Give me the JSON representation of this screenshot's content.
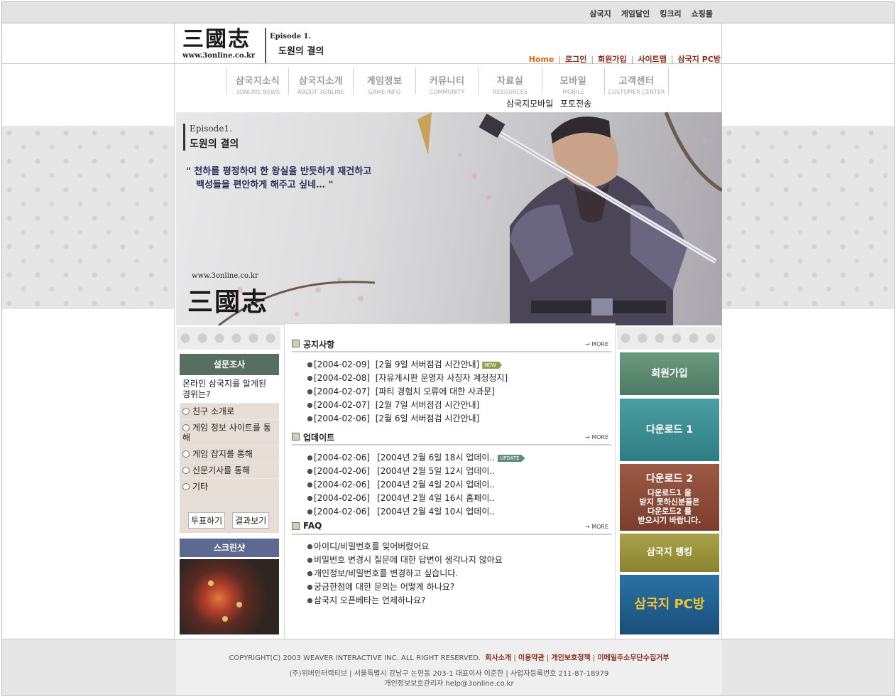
{
  "topbar": {
    "links": [
      "삼국지",
      "게임달인",
      "킹크리",
      "쇼핑몰"
    ]
  },
  "header": {
    "logo_hanja": "三國志",
    "logo_url": "www.3online.co.kr",
    "episode_label": "Episode 1.",
    "episode_title": "도원의 결의",
    "nav": {
      "home": "Home",
      "login": "로그인",
      "join": "회원가입",
      "sitemap": "사이트맵",
      "pcbang": "삼국지 PC방",
      "separator": "|"
    }
  },
  "menu": [
    {
      "ko": "삼국지소식",
      "en": "3ONLINE NEWS"
    },
    {
      "ko": "삼국지소개",
      "en": "ABOUT 3ONLINE"
    },
    {
      "ko": "게임정보",
      "en": "GAME INFO"
    },
    {
      "ko": "커뮤니티",
      "en": "COMMUNITY"
    },
    {
      "ko": "자료실",
      "en": "RESOURCES"
    },
    {
      "ko": "모바일",
      "en": "MOBILE"
    },
    {
      "ko": "고객센터",
      "en": "CUSTOMER CENTER"
    }
  ],
  "submenu": "삼국지모바일 포토전송",
  "hero": {
    "episode": "Episode1.",
    "title": "도원의 결의",
    "quote_line1": "\" 천하를 평정하여 한 왕실을 반듯하게 재건하고",
    "quote_line2": "백성들을 편안하게 해주고 싶네… \"",
    "url": "www.3online.co.kr",
    "hanja": "三國志"
  },
  "poll": {
    "title": "설문조사",
    "question": "온라인 삼국지를 알게된 경위는?",
    "options": [
      "친구 소개로",
      "게임 정보 사이트를 통해",
      "게임 잡지를 통해",
      "신문기사를 통해",
      "기타"
    ],
    "vote": "투표하기",
    "results": "결과보기"
  },
  "screenshot": {
    "title": "스크린샷"
  },
  "notice": {
    "title": "공지사항",
    "more": "→ MORE",
    "new_badge": "NEW",
    "items": [
      {
        "date": "[2004-02-09]",
        "text": "[2월 9일 서버점검 시간안내]"
      },
      {
        "date": "[2004-02-08]",
        "text": "[자유게시판 운영자 사칭자 계정정지]"
      },
      {
        "date": "[2004-02-07]",
        "text": "[파티 경험치 오류에 대한 사과문]"
      },
      {
        "date": "[2004-02-07]",
        "text": "[2월 7일 서버점검 시간안내]"
      },
      {
        "date": "[2004-02-06]",
        "text": "[2월 6일 서버점검 시간안내]"
      }
    ]
  },
  "update": {
    "title": "업데이트",
    "more": "→ MORE",
    "badge": "UPDATE",
    "items": [
      {
        "date": "[2004-02-06]",
        "text": "[2004년 2월 6일 18시 업데이.."
      },
      {
        "date": "[2004-02-06]",
        "text": "[2004년 2월 5일 12시 업데이.."
      },
      {
        "date": "[2004-02-06]",
        "text": "[2004년 2월 4일 20시 업데이.."
      },
      {
        "date": "[2004-02-06]",
        "text": "[2004년 2월 4일 16시 홈페이.."
      },
      {
        "date": "[2004-02-06]",
        "text": "[2004년 2월 4일 10시 업데이.."
      }
    ]
  },
  "faq": {
    "title": "FAQ",
    "more": "→ MORE",
    "items": [
      "아이디/비밀번호를 잊어버렸어요",
      "비밀번호 변경시 질문에 대한 답변이 생각나지 않아요",
      "개인정보/비밀번호를 변경하고 싶습니다.",
      "궁금한점에 대한 문의는 어떻게 하나요?",
      "삼국지 오픈베타는 언제하나요?"
    ]
  },
  "right": {
    "join": "회원가입",
    "download1": "다운로드 1",
    "download2": "다운로드 2",
    "download2_note_1": "다운로드1 을",
    "download2_note_2": "받지 못하신분들은",
    "download2_note_3": "다운로드2 를",
    "download2_note_4": "받으시기 바랍니다.",
    "ranking": "삼국지 랭킹",
    "pcbang": "삼국지 PC방"
  },
  "footer": {
    "copyright": "COPYRIGHT(C) 2003 WEAVER INTERACTIVE INC. ALL RIGHT RESERVED.",
    "links": [
      "회사소개",
      "이용약관",
      "개인보호정책",
      "이메일주소무단수집거부"
    ],
    "address": "(주)위버인터랙티브 | 서울특별시 강남구 논현동 203-1 대표이사 이준한 | 사업자등록번호 211-87-18979",
    "privacy": "개인정보보호관리자  help@3online.co.kr"
  }
}
